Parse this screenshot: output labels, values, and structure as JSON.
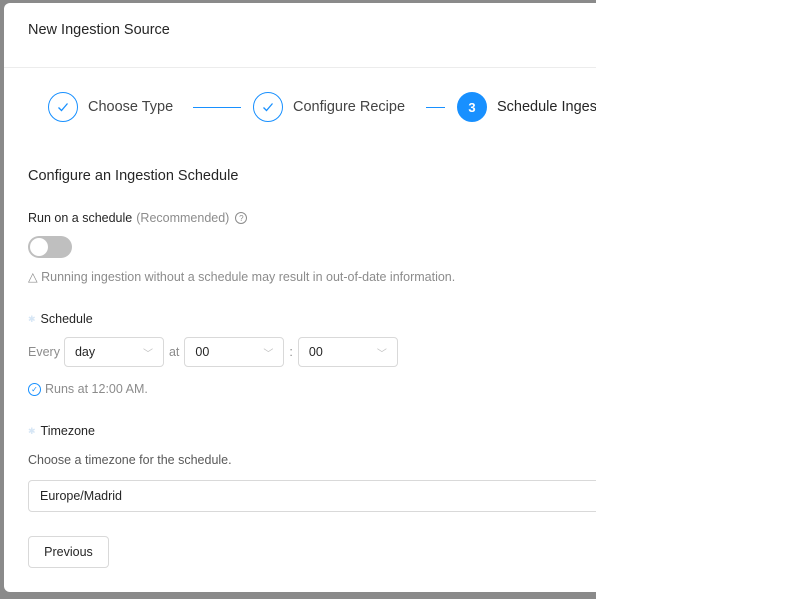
{
  "modal": {
    "title": "New Ingestion Source"
  },
  "steps": [
    {
      "label": "Choose Type",
      "status": "done",
      "icon": "check-icon"
    },
    {
      "label": "Configure Recipe",
      "status": "done",
      "icon": "check-icon"
    },
    {
      "label": "Schedule Ingestion",
      "visible_label": "Schedule Inges",
      "status": "active",
      "number": "3"
    }
  ],
  "form": {
    "section_title": "Configure an Ingestion Schedule",
    "run_schedule_label": "Run on a schedule",
    "run_schedule_hint": "(Recommended)",
    "toggle_on": false,
    "warning_icon": "△",
    "warning": "Running ingestion without a schedule may result in out-of-date information.",
    "schedule_label": "Schedule",
    "every_label": "Every",
    "frequency_value": "day",
    "at_label": "at",
    "hour_value": "00",
    "colon": ":",
    "minute_value": "00",
    "runs_at": "Runs at 12:00 AM.",
    "timezone_label": "Timezone",
    "timezone_helper": "Choose a timezone for the schedule.",
    "timezone_value": "Europe/Madrid"
  },
  "footer": {
    "previous_label": "Previous"
  },
  "colors": {
    "accent": "#1890ff",
    "backdrop": "#8a8a8a"
  }
}
